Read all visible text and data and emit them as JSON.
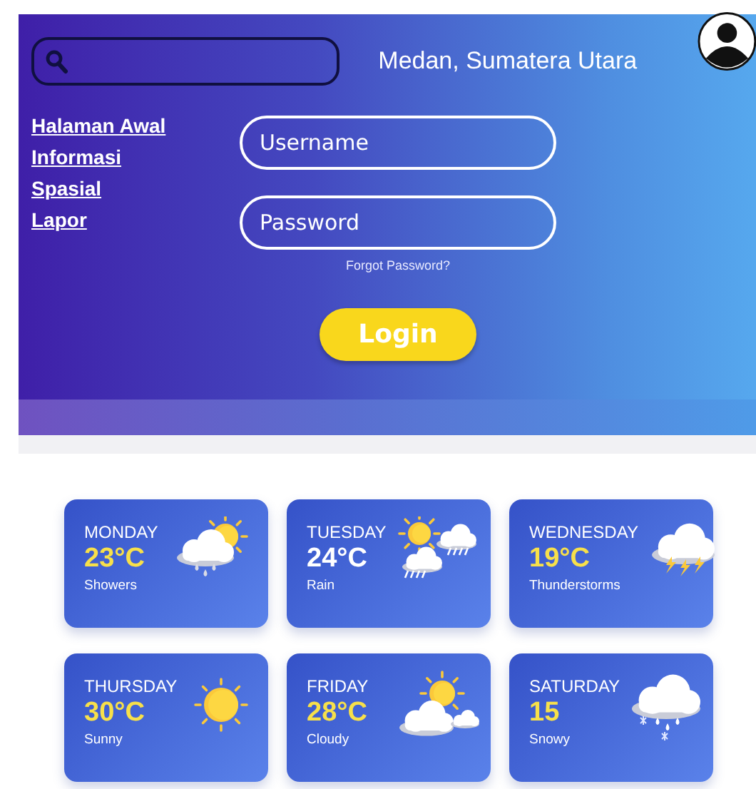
{
  "location": "Medan, Sumatera Utara",
  "nav": [
    "Halaman Awal",
    "Informasi",
    "Spasial",
    "Lapor"
  ],
  "login": {
    "username": {
      "placeholder": "Username"
    },
    "password": {
      "placeholder": "Password"
    },
    "forgot": "Forgot Password?",
    "button": "Login"
  },
  "forecast": [
    {
      "day": "MONDAY",
      "temp": "23°C",
      "condition": "Showers",
      "kind": "showers",
      "color": "#f7e04a"
    },
    {
      "day": "TUESDAY",
      "temp": "24°C",
      "condition": "Rain",
      "kind": "rain",
      "color": "#ffffff"
    },
    {
      "day": "WEDNESDAY",
      "temp": "19°C",
      "condition": "Thunderstorms",
      "kind": "thunderstorms",
      "color": "#f7e04a"
    },
    {
      "day": "THURSDAY",
      "temp": "30°C",
      "condition": "Sunny",
      "kind": "sunny",
      "color": "#f7e04a"
    },
    {
      "day": "FRIDAY",
      "temp": "28°C",
      "condition": "Cloudy",
      "kind": "cloudy",
      "color": "#f7e04a"
    },
    {
      "day": "SATURDAY",
      "temp": "15",
      "condition": "Snowy",
      "kind": "snowy",
      "color": "#f7e04a"
    }
  ]
}
